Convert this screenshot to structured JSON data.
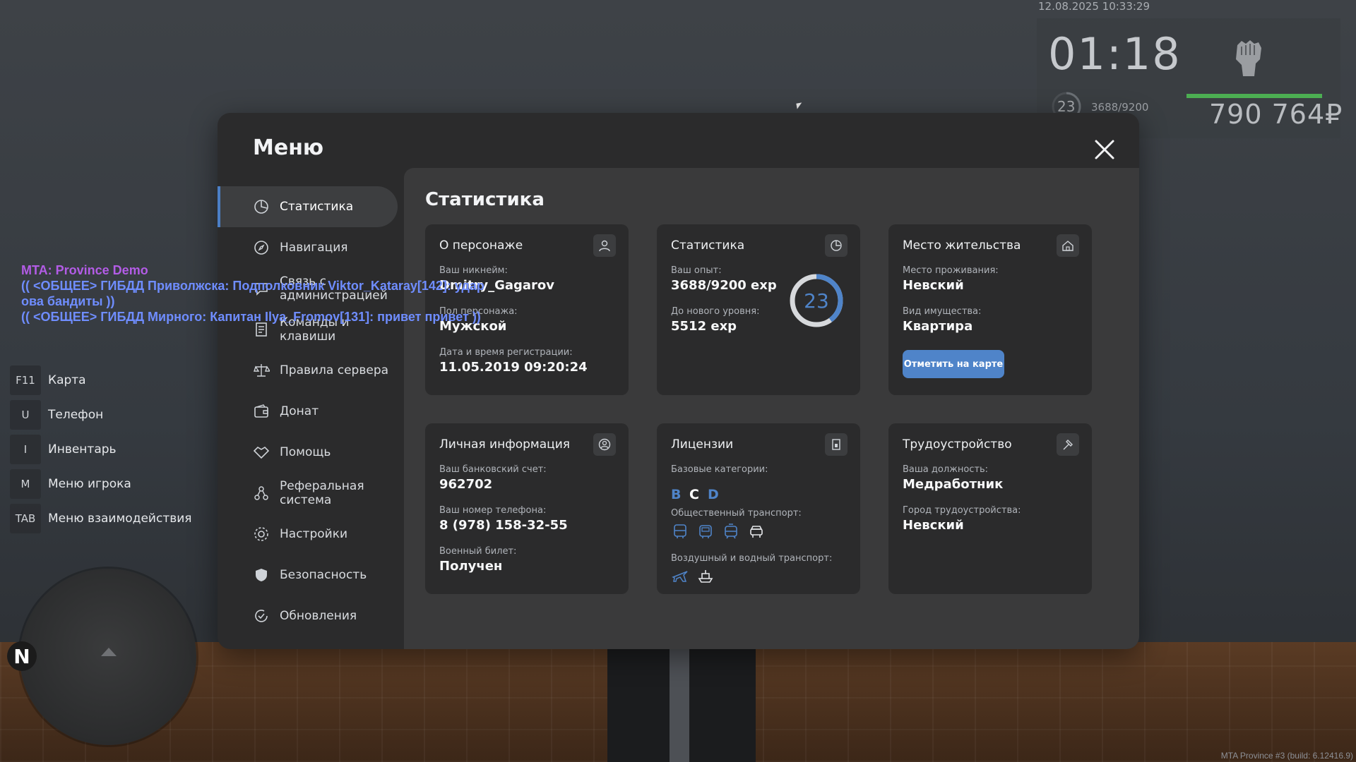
{
  "hud": {
    "datetime": "12.08.2025 10:33:29",
    "time": "01:18",
    "level": "23",
    "exp": "3688/9200",
    "health_fraction": 0.96,
    "money": "790 764₽",
    "icon": "fist-icon"
  },
  "hotkeys": [
    {
      "key": "F11",
      "label": "Карта"
    },
    {
      "key": "U",
      "label": "Телефон"
    },
    {
      "key": "I",
      "label": "Инвентарь"
    },
    {
      "key": "M",
      "label": "Меню игрока"
    },
    {
      "key": "TAB",
      "label": "Меню взаимодействия"
    }
  ],
  "radar": {
    "north": "N"
  },
  "chat": {
    "server": "MTA: Province Demo",
    "lines": [
      "(( <ОБЩЕЕ> ГИБДД Приволжска: Подполковник Viktor_Kataray[142]: удар",
      "ова бандиты ))",
      "(( <ОБЩЕЕ> ГИБДД Мирного: Капитан Ilya_Fromov[131]: привет привет ))"
    ]
  },
  "menu": {
    "title": "Меню",
    "nav": [
      {
        "label": "Статистика",
        "icon": "pie-chart-icon",
        "active": true
      },
      {
        "label": "Навигация",
        "icon": "compass-icon"
      },
      {
        "label": "Связь с администрацией",
        "icon": "chat-icon"
      },
      {
        "label": "Команды и клавиши",
        "icon": "document-icon"
      },
      {
        "label": "Правила сервера",
        "icon": "scales-icon"
      },
      {
        "label": "Донат",
        "icon": "wallet-icon"
      },
      {
        "label": "Помощь",
        "icon": "handshake-icon"
      },
      {
        "label": "Реферальная система",
        "icon": "referral-icon"
      },
      {
        "label": "Настройки",
        "icon": "gear-icon"
      },
      {
        "label": "Безопасность",
        "icon": "shield-icon"
      },
      {
        "label": "Обновления",
        "icon": "refresh-icon"
      }
    ],
    "content_title": "Статистика",
    "cards": {
      "character": {
        "title": "О персонаже",
        "nickname_label": "Ваш никнейм:",
        "nickname": "Dmitry_Gagarov",
        "gender_label": "Пол персонажа:",
        "gender": "Мужской",
        "reg_label": "Дата и время регистрации:",
        "reg": "11.05.2019 09:20:24"
      },
      "stats": {
        "title": "Статистика",
        "exp_label": "Ваш опыт:",
        "exp": "3688/9200 exp",
        "next_label": "До нового уровня:",
        "next": "5512 exp",
        "level": "23",
        "progress": 0.4
      },
      "residence": {
        "title": "Место жительства",
        "place_label": "Место проживания:",
        "place": "Невский",
        "type_label": "Вид имущества:",
        "type": "Квартира",
        "button": "Отметить на карте"
      },
      "personal": {
        "title": "Личная информация",
        "bank_label": "Ваш банковский счет:",
        "bank": "962702",
        "phone_label": "Ваш номер телефона:",
        "phone": "8 (978) 158-32-55",
        "military_label": "Военный билет:",
        "military": "Получен"
      },
      "licenses": {
        "title": "Лицензии",
        "base_label": "Базовые категории:",
        "categories": [
          {
            "letter": "B",
            "color": "#4f84c9"
          },
          {
            "letter": "C",
            "color": "#ffffff"
          },
          {
            "letter": "D",
            "color": "#4f84c9"
          }
        ],
        "public_label": "Общественный транспорт:",
        "public_icons": [
          "bus-icon",
          "trolleybus-icon",
          "tram-icon",
          "taxi-icon"
        ],
        "air_label": "Воздушный и водный транспорт:",
        "air_icons": [
          "plane-icon",
          "boat-icon"
        ]
      },
      "job": {
        "title": "Трудоустройство",
        "position_label": "Ваша должность:",
        "position": "Медработник",
        "city_label": "Город трудоустройства:",
        "city": "Невский"
      }
    }
  },
  "build": "MTA Province #3 (build: 6.12416.9)"
}
